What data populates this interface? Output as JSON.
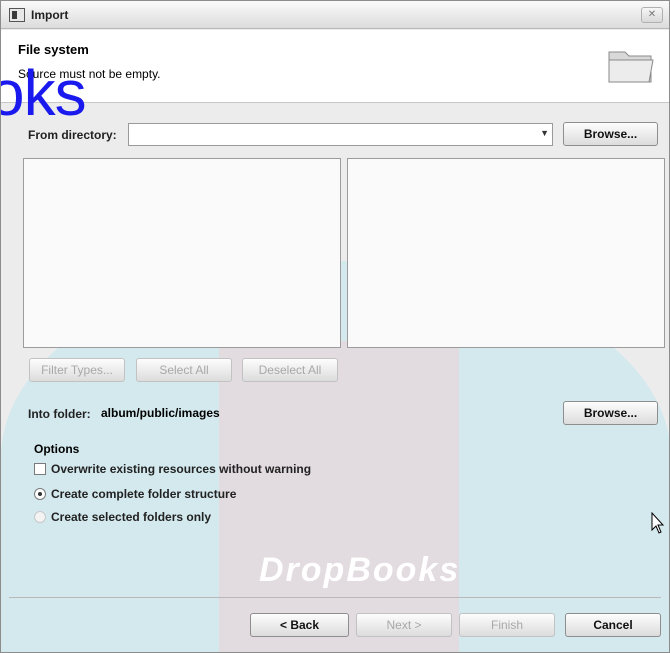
{
  "window": {
    "title": "Import",
    "close_label": "✕"
  },
  "header": {
    "title": "File system",
    "message": "Source must not be empty."
  },
  "watermark": {
    "overlay_text": "oks",
    "brand_text": "DropBooks"
  },
  "source": {
    "from_label": "From directory:",
    "value": "",
    "browse_label": "Browse..."
  },
  "selection_buttons": {
    "filter_types": "Filter Types...",
    "select_all": "Select All",
    "deselect_all": "Deselect All"
  },
  "destination": {
    "into_label": "Into folder:",
    "value": "album/public/images",
    "browse_label": "Browse..."
  },
  "options": {
    "heading": "Options",
    "overwrite": {
      "label": "Overwrite existing resources without warning",
      "checked": false
    },
    "complete_structure": {
      "label": "Create complete folder structure",
      "selected": true
    },
    "selected_only": {
      "label": "Create selected folders only",
      "selected": false
    }
  },
  "footer": {
    "back": "< Back",
    "next": "Next >",
    "finish": "Finish",
    "cancel": "Cancel"
  }
}
